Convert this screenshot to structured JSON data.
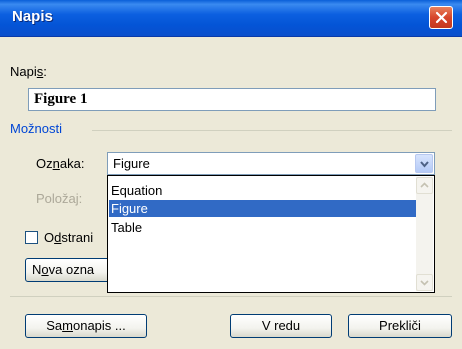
{
  "window": {
    "title": "Napis",
    "close_icon": "close-icon"
  },
  "caption": {
    "label_prefix": "Napi",
    "label_u": "s",
    "label_suffix": ":",
    "value": "Figure 1"
  },
  "options": {
    "group_title": "Možnosti"
  },
  "label_field": {
    "label_prefix": "Oz",
    "label_u": "n",
    "label_suffix": "aka:",
    "value": "Figure"
  },
  "position_field": {
    "label": "Položaj:"
  },
  "dropdown": {
    "items": [
      "Equation",
      "Figure",
      "Table"
    ],
    "selected": "Figure"
  },
  "exclude_checkbox": {
    "label_prefix": "O",
    "label_u": "d",
    "label_suffix": "strani",
    "checked": false
  },
  "new_label_button": {
    "label_prefix": "N",
    "label_u": "o",
    "label_suffix": "va ozna"
  },
  "autocaption_button": {
    "label_prefix": "Sa",
    "label_u": "m",
    "label_suffix": "onapis ..."
  },
  "ok_button": {
    "label": "V redu"
  },
  "cancel_button": {
    "label": "Prekliči"
  }
}
